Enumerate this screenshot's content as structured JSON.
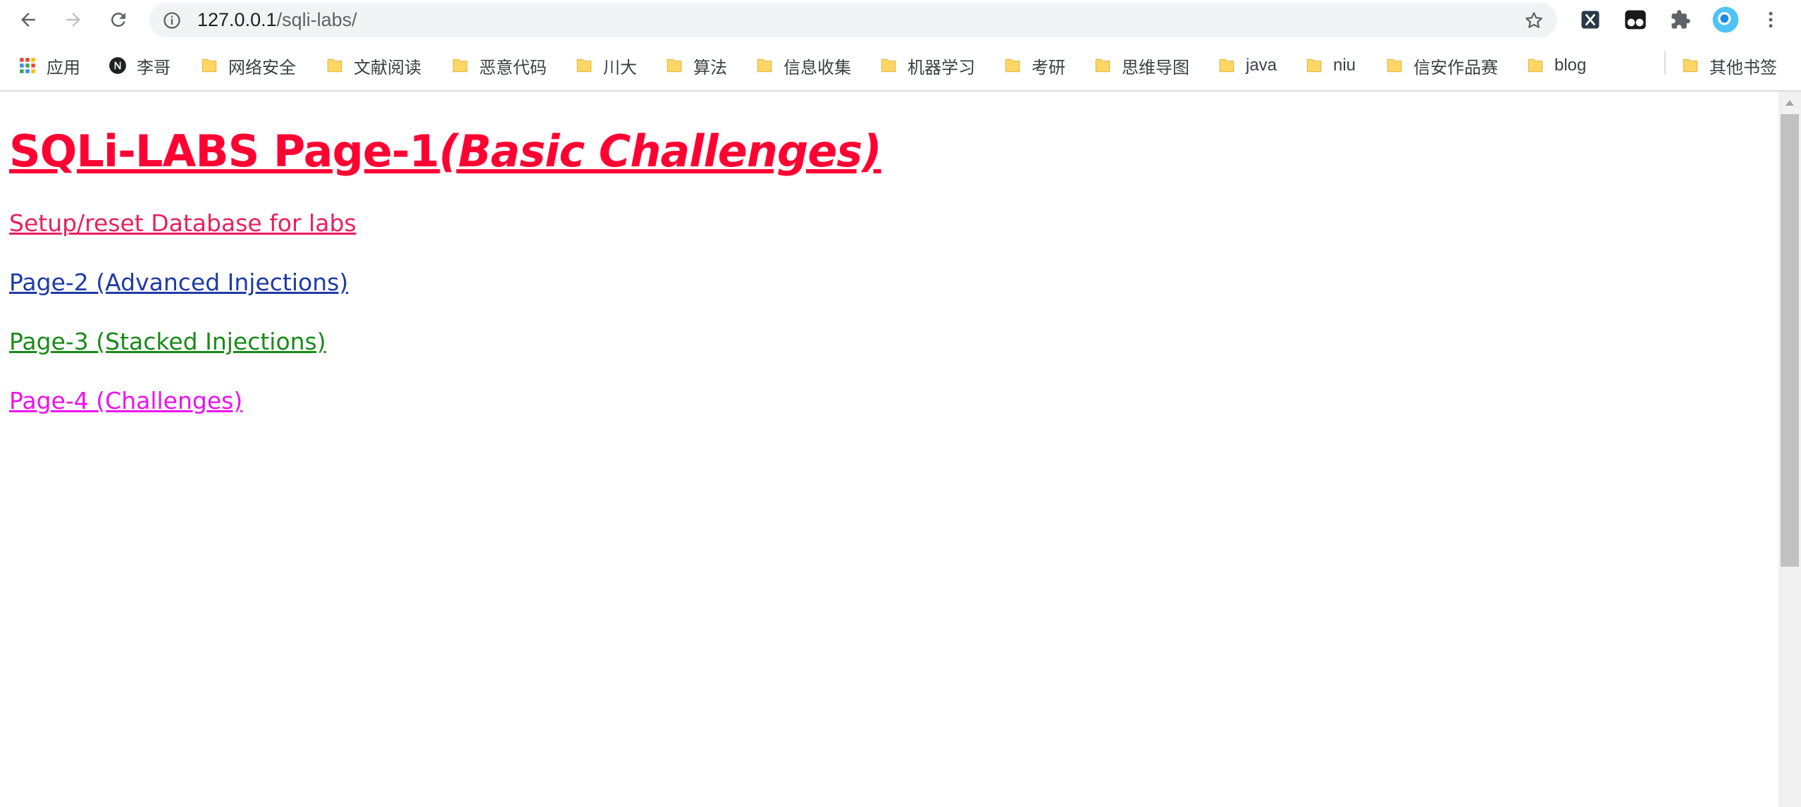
{
  "browser": {
    "url_host": "127.0.0.1",
    "url_path": "/sqli-labs/",
    "icons": {
      "back": "back-arrow-icon",
      "forward": "forward-arrow-icon",
      "reload": "reload-icon",
      "info": "info-icon",
      "star": "star-icon",
      "extensions": [
        "x-extension-icon",
        "tampermonkey-icon",
        "puzzle-icon",
        "profile-avatar-icon",
        "kebab-menu-icon"
      ]
    }
  },
  "bookmarks": {
    "apps": "应用",
    "items": [
      "李哥",
      "网络安全",
      "文献阅读",
      "恶意代码",
      "川大",
      "算法",
      "信息收集",
      "机器学习",
      "考研",
      "思维导图",
      "java",
      "niu",
      "信安作品赛",
      "blog"
    ],
    "other": "其他书签"
  },
  "page": {
    "title_main": "SQLi-LABS Page-1",
    "title_sub": "(Basic Challenges)",
    "links": [
      "Setup/reset Database for labs",
      "Page-2 (Advanced Injections)",
      "Page-3 (Stacked Injections)",
      "Page-4 (Challenges)"
    ]
  },
  "colors": {
    "title": "#ff0033",
    "link_setup": "#e8205e",
    "link_page2": "#1f3ba5",
    "link_page3": "#1a8a1a",
    "link_page4": "#ee11ee",
    "folder": "#fdd663"
  }
}
